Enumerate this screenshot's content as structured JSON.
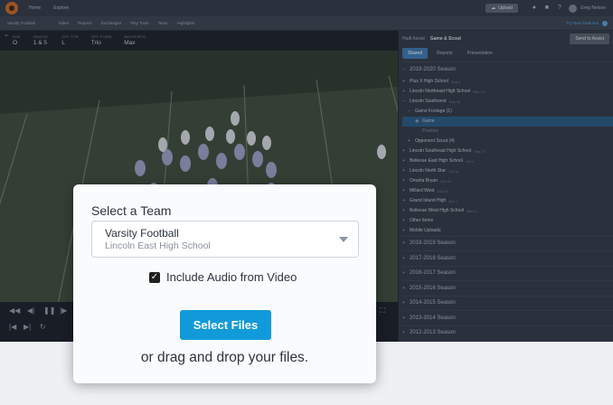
{
  "topbar": {
    "nav": [
      "Home",
      "Explore"
    ],
    "upload_label": "Upload",
    "user_name": "Greg Nelson"
  },
  "subnav": {
    "team": "Varsity Football",
    "items": [
      "Video",
      "Reports",
      "Exchanges",
      "Play Tools",
      "Team",
      "Highlights"
    ],
    "suggestion": "Try New Features"
  },
  "play_meta": [
    {
      "label": "DSK",
      "value": "O"
    },
    {
      "label": "DN/DIST",
      "value": "1 & 5"
    },
    {
      "label": "OFF STR",
      "value": "L"
    },
    {
      "label": "OFF FORM",
      "value": "Trio"
    },
    {
      "label": "BACKFIELD",
      "value": "Max"
    }
  ],
  "panel": {
    "title_muted": "Hudl Assist",
    "title": "Game & Scout",
    "send_button": "Send to Assist",
    "tabs": [
      "Shared",
      "Reports",
      "Presentation"
    ],
    "tree": [
      {
        "kind": "season",
        "pm": "−",
        "label": "2019-2020 Season"
      },
      {
        "kind": "item",
        "pm": "+",
        "label": "Pius X High School",
        "note": "Sep 6"
      },
      {
        "kind": "item",
        "pm": "+",
        "label": "Lincoln Northeast High School",
        "note": "Sep 13"
      },
      {
        "kind": "item",
        "pm": "−",
        "label": "Lincoln Southwest",
        "note": "Sep 20"
      },
      {
        "kind": "sub",
        "pm": "−",
        "label": "Game Footage (1)"
      },
      {
        "kind": "selected",
        "pm": "◉",
        "label": "Game"
      },
      {
        "kind": "dim",
        "pm": "",
        "label": "Practice"
      },
      {
        "kind": "sub",
        "pm": "+",
        "label": "Opponent Scout (4)"
      },
      {
        "kind": "item",
        "pm": "+",
        "label": "Lincoln Southeast High School",
        "note": "Sep 27"
      },
      {
        "kind": "item",
        "pm": "+",
        "label": "Bellevue East High School",
        "note": "Oct 4"
      },
      {
        "kind": "item",
        "pm": "+",
        "label": "Lincoln North Star",
        "note": "Oct 11"
      },
      {
        "kind": "item",
        "pm": "+",
        "label": "Omaha Bryan",
        "note": "Oct 18"
      },
      {
        "kind": "item",
        "pm": "+",
        "label": "Millard West",
        "note": "Oct 25"
      },
      {
        "kind": "item",
        "pm": "+",
        "label": "Grand Island High",
        "note": "Nov 1"
      },
      {
        "kind": "item",
        "pm": "+",
        "label": "Bellevue West High School",
        "note": "Nov 8"
      },
      {
        "kind": "item",
        "pm": "+",
        "label": "Other Items",
        "note": ""
      },
      {
        "kind": "item",
        "pm": "+",
        "label": "Mobile Uploads",
        "note": ""
      },
      {
        "kind": "season",
        "pm": "+",
        "label": "2018-2019 Season"
      },
      {
        "kind": "season",
        "pm": "+",
        "label": "2017-2018 Season"
      },
      {
        "kind": "season",
        "pm": "+",
        "label": "2016-2017 Season"
      },
      {
        "kind": "season",
        "pm": "+",
        "label": "2015-2016 Season"
      },
      {
        "kind": "season",
        "pm": "+",
        "label": "2014-2015 Season"
      },
      {
        "kind": "season",
        "pm": "+",
        "label": "2013-2014 Season"
      },
      {
        "kind": "season",
        "pm": "+",
        "label": "2012-2013 Season"
      }
    ]
  },
  "modal": {
    "select_label": "Select a Team",
    "team_name": "Varsity Football",
    "school_name": "Lincoln East High School",
    "include_audio_label": "Include Audio from Video",
    "include_audio_checked": true,
    "select_files_button": "Select Files",
    "drag_text": "or drag and drop your files."
  },
  "colors": {
    "accent": "#119ad9",
    "app_bg": "#2b3340",
    "page_bg": "#eef0f3"
  }
}
